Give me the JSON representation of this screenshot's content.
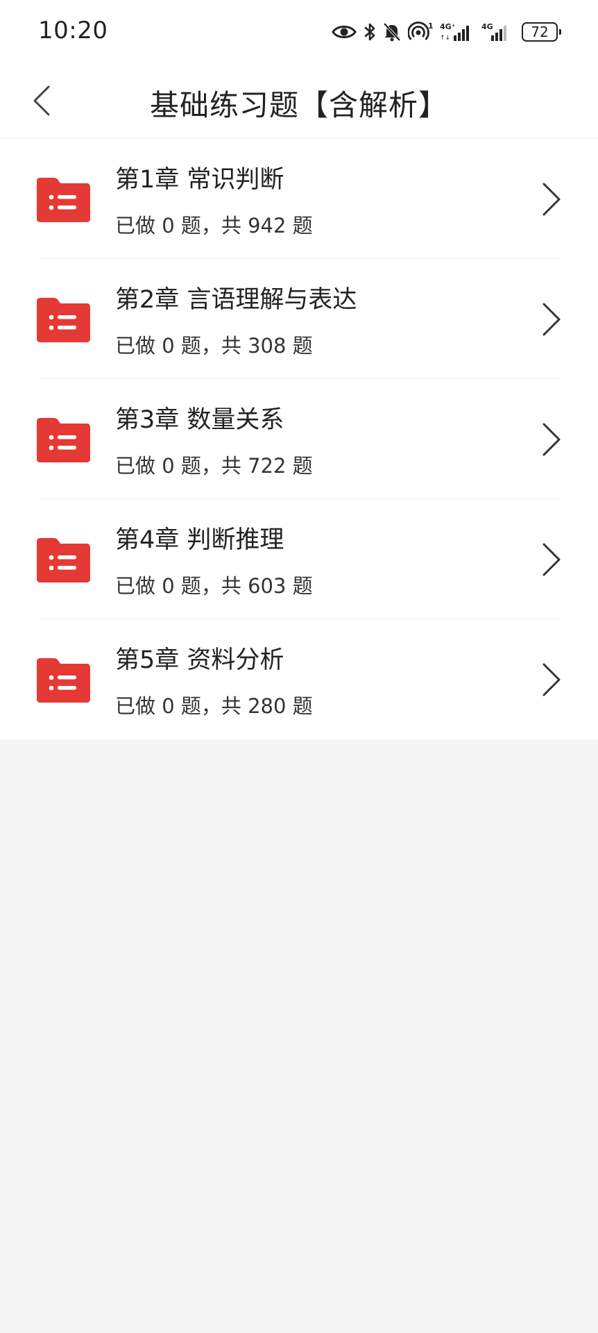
{
  "status_bar": {
    "time": "10:20",
    "network_1": "4G⁺",
    "network_2": "4G",
    "network_sup": "1",
    "battery": "72",
    "icons": [
      "eye-icon",
      "bluetooth-icon",
      "mute-bell-icon",
      "hotspot-icon",
      "signal-icon",
      "signal-icon",
      "battery-icon"
    ]
  },
  "header": {
    "title": "基础练习题【含解析】",
    "back_icon": "chevron-left-icon"
  },
  "chapters": [
    {
      "title": "第1章 常识判断",
      "progress": "已做 0 题，共 942 题"
    },
    {
      "title": "第2章 言语理解与表达",
      "progress": "已做 0 题，共 308 题"
    },
    {
      "title": "第3章 数量关系",
      "progress": "已做 0 题，共 722 题"
    },
    {
      "title": "第4章 判断推理",
      "progress": "已做 0 题，共 603 题"
    },
    {
      "title": "第5章 资料分析",
      "progress": "已做 0 题，共 280 题"
    }
  ],
  "colors": {
    "accent": "#e53935",
    "background": "#f5f5f5",
    "surface": "#ffffff",
    "text": "#222222"
  }
}
